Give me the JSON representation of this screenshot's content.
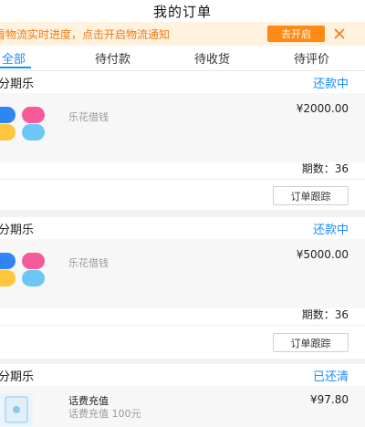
{
  "page": {
    "title": "我的订单"
  },
  "notice": {
    "text": "看物流实时进度，点击开启物流通知",
    "button_label": "去开启"
  },
  "tabs": [
    {
      "label": "全部",
      "active": true
    },
    {
      "label": "待付款",
      "active": false
    },
    {
      "label": "待收货",
      "active": false
    },
    {
      "label": "待评价",
      "active": false
    }
  ],
  "orders": [
    {
      "store": "分期乐",
      "status": "还款中",
      "product": "乐花借钱",
      "price": "¥2000.00",
      "periods": "期数：36",
      "track_label": "订单跟踪"
    },
    {
      "store": "分期乐",
      "status": "还款中",
      "product": "乐花借钱",
      "price": "¥5000.00",
      "periods": "期数：36",
      "track_label": "订单跟踪"
    },
    {
      "store": "分期乐",
      "status": "已还清",
      "product": "话费充值",
      "product_desc": "话费充值 100元",
      "price": "¥97.80"
    }
  ],
  "colors": {
    "accent": "#1a8cff",
    "notice_bg": "#fff2df",
    "notice_text": "#f07b19",
    "notice_button": "#ff8a14"
  },
  "icons": {
    "close": "close-icon",
    "product_logo": "lehua-logo-icon",
    "phone_topup": "phone-topup-icon"
  }
}
